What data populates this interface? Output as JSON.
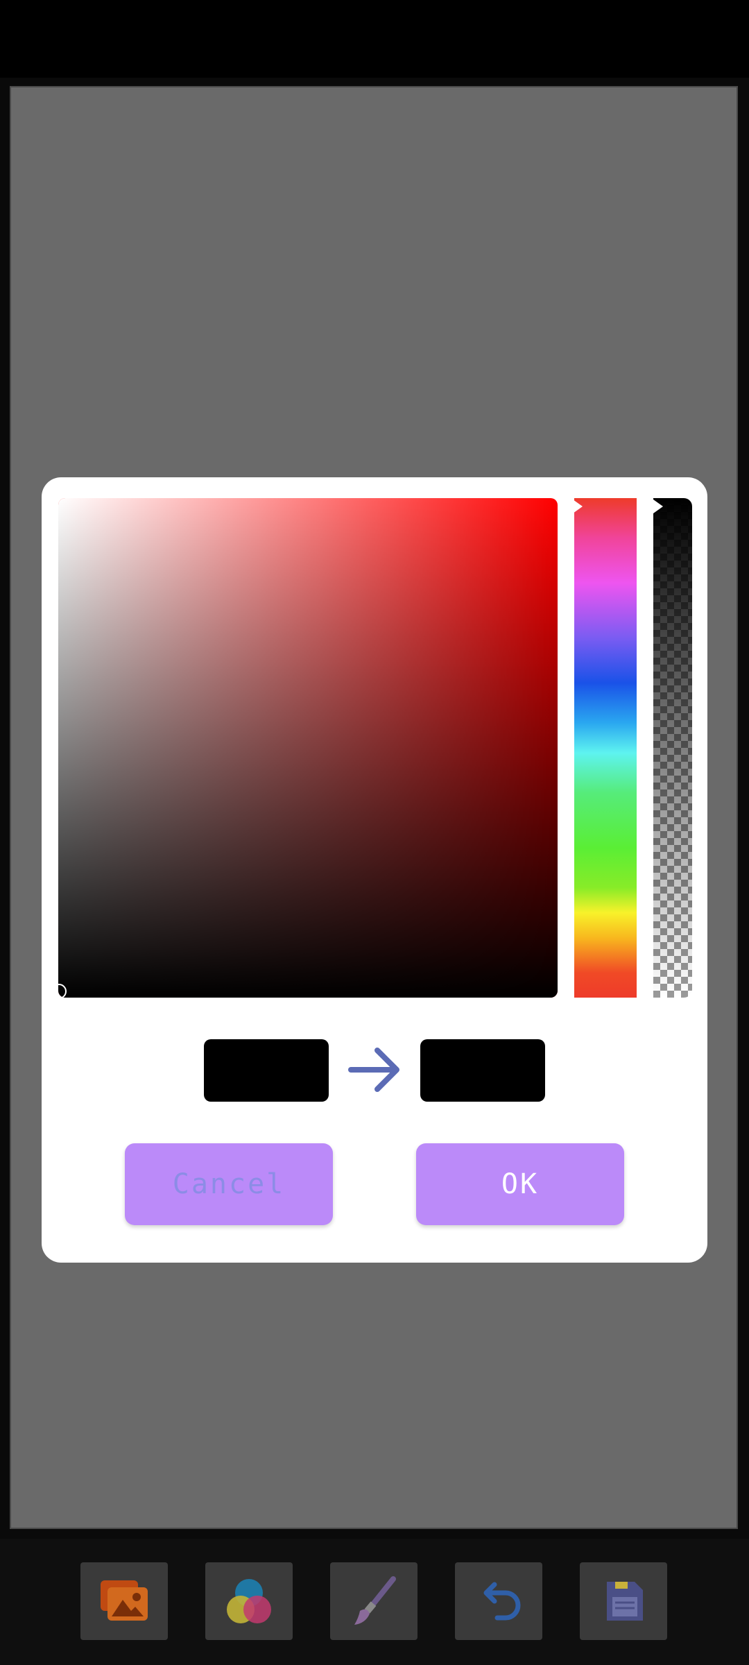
{
  "colors": {
    "hue": "#ff0000",
    "old_color": "#000000",
    "new_color": "#000000",
    "button_bg": "#bb8af9",
    "cancel_text": "#8c8ce6",
    "ok_text": "#ffffff",
    "arrow": "#5b6bb5"
  },
  "dialog": {
    "cancel_label": "Cancel",
    "ok_label": "OK"
  },
  "toolbar": {
    "items": [
      {
        "icon": "image-icon"
      },
      {
        "icon": "color-palette-icon"
      },
      {
        "icon": "brush-icon"
      },
      {
        "icon": "undo-icon"
      },
      {
        "icon": "save-icon"
      }
    ]
  }
}
